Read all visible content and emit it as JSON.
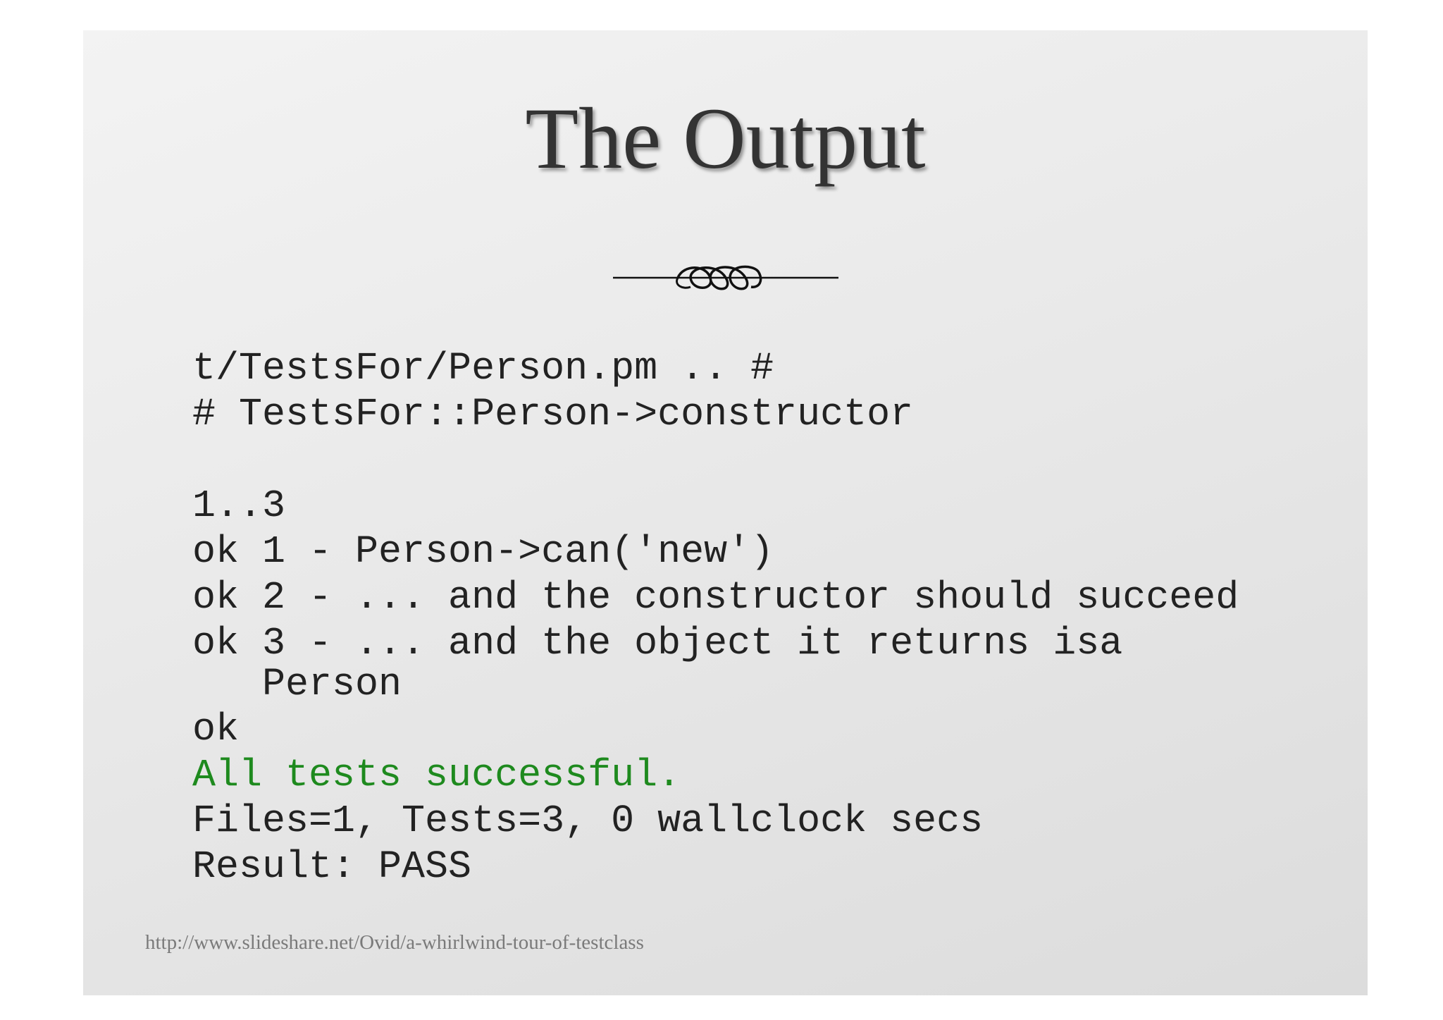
{
  "slide": {
    "title": "The Output",
    "ornament_icon": "flourish-divider-icon",
    "code_lines": [
      "t/TestsFor/Person.pm .. #",
      "# TestsFor::Person->constructor",
      "1..3",
      "ok 1 - Person->can('new')",
      "ok 2 - ... and the constructor should succeed",
      "ok 3 - ... and the object it returns isa",
      "   Person",
      "ok",
      "All tests successful.",
      "Files=1, Tests=3, 0 wallclock secs",
      "Result: PASS"
    ],
    "source_url": "http://www.slideshare.net/Ovid/a-whirlwind-tour-of-testclass",
    "colors": {
      "text": "#222222",
      "success": "#1e8a1e",
      "title": "#333333"
    }
  }
}
